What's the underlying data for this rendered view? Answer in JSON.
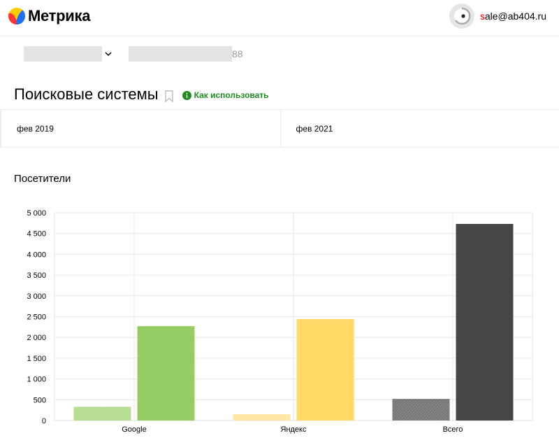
{
  "app": {
    "logo_text": "Метрика",
    "logo_colors": [
      "#ffcc00",
      "#ff3333",
      "#1e6fff"
    ]
  },
  "user": {
    "email_first_letter": "s",
    "email_rest": "ale@ab404.ru",
    "avatar_icon": "avatar-ring-icon"
  },
  "counter": {
    "id_suffix": "88"
  },
  "page": {
    "title": "Поисковые системы",
    "howto_label": "Как использовать"
  },
  "periods": [
    {
      "label": "фев 2019"
    },
    {
      "label": "фев 2021"
    }
  ],
  "metric": {
    "title": "Посетители"
  },
  "chart_data": {
    "type": "bar",
    "categories": [
      "Google",
      "Яндекс",
      "Всего"
    ],
    "series": [
      {
        "values": [
          330,
          150,
          520
        ]
      },
      {
        "values": [
          2270,
          2440,
          4730
        ]
      }
    ],
    "colors": {
      "Google": [
        "#b5db8f",
        "#95cc63"
      ],
      "Яндекс": [
        "#ffe6a0",
        "#ffd966"
      ],
      "Всего": [
        "#777777",
        "#464646"
      ]
    },
    "ylim": [
      0,
      5000
    ],
    "yticks": [
      0,
      500,
      1000,
      1500,
      2000,
      2500,
      3000,
      3500,
      4000,
      4500,
      5000
    ],
    "ytick_labels": [
      "0",
      "500",
      "1 000",
      "1 500",
      "2 000",
      "2 500",
      "3 000",
      "3 500",
      "4 000",
      "4 500",
      "5 000"
    ],
    "grid": true
  }
}
